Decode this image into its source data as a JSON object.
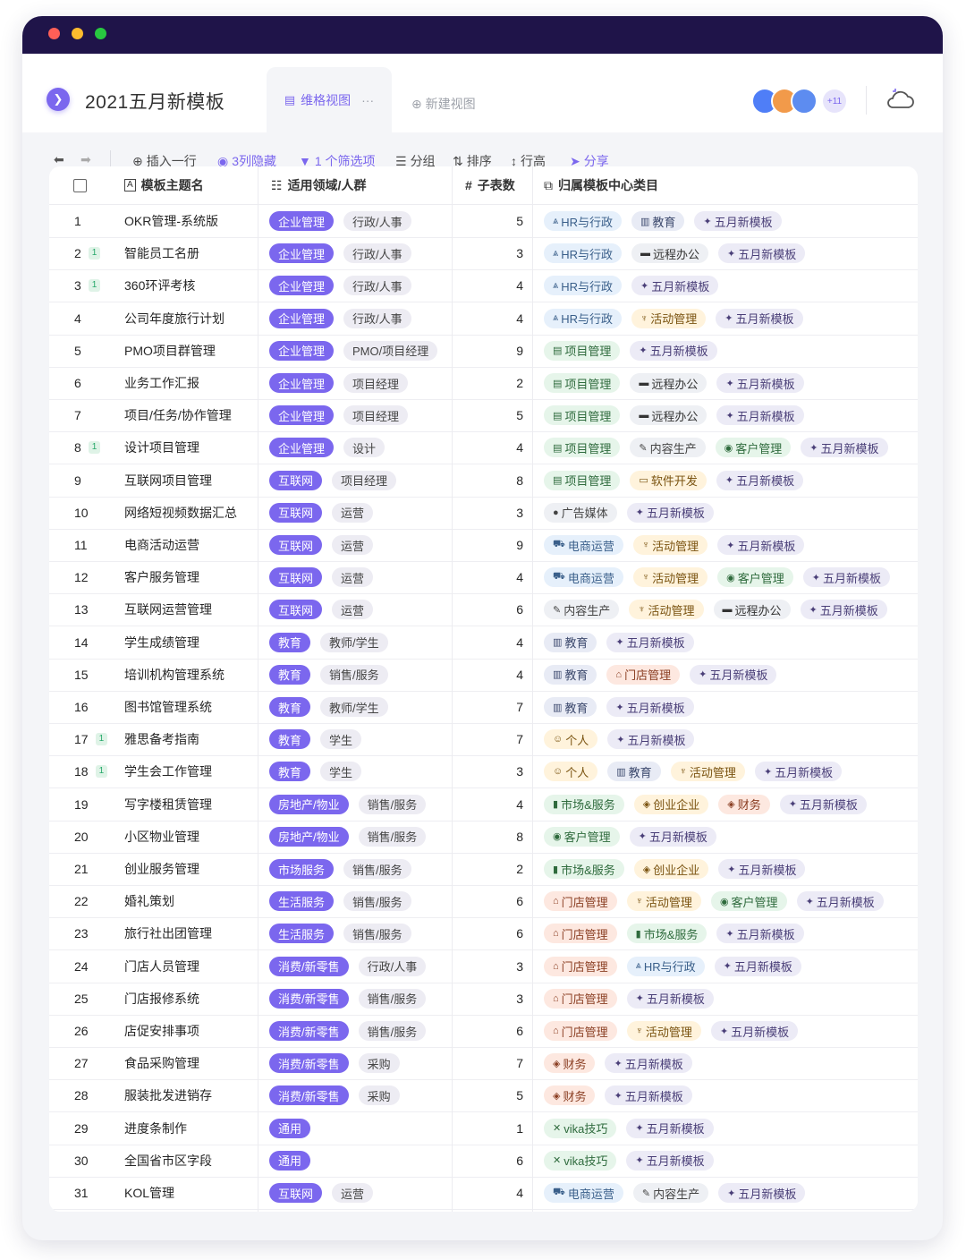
{
  "app": {
    "title": "2021五月新模板",
    "tab_active": "维格视图",
    "tab_more": "···",
    "tab_new": "新建视图",
    "collab_more": "+11"
  },
  "toolbar": {
    "insert_row": "插入一行",
    "hidden_cols": "3列隐藏",
    "filter": "1 个筛选项",
    "group": "分组",
    "sort": "排序",
    "row_height": "行高",
    "share": "分享"
  },
  "columns": {
    "name": "模板主题名",
    "domain": "适用领域/人群",
    "count": "子表数",
    "category": "归属模板中心类目"
  },
  "colors": {
    "accent": "#7b67ee",
    "titlebar": "#1f1449",
    "badge_green": "#27a86a"
  },
  "category_styles": {
    "HR与行政": {
      "icon": "⩓",
      "bg": "#e6f0fb",
      "fg": "#3a5f8a"
    },
    "教育": {
      "icon": "▥",
      "bg": "#e8ebf5",
      "fg": "#3d4a6e"
    },
    "五月新模板": {
      "icon": "✦",
      "bg": "#ecebf6",
      "fg": "#4a3f78"
    },
    "远程办公": {
      "icon": "▬",
      "bg": "#eef0f4",
      "fg": "#333"
    },
    "活动管理": {
      "icon": "♆",
      "bg": "#fff3dc",
      "fg": "#7a5310"
    },
    "项目管理": {
      "icon": "▤",
      "bg": "#e6f5ea",
      "fg": "#2f6b3d"
    },
    "内容生产": {
      "icon": "✎",
      "bg": "#eef0f4",
      "fg": "#444"
    },
    "客户管理": {
      "icon": "◉",
      "bg": "#e6f5ea",
      "fg": "#2f6b3d"
    },
    "软件开发": {
      "icon": "▭",
      "bg": "#fff3dc",
      "fg": "#7a5310"
    },
    "广告媒体": {
      "icon": "●",
      "bg": "#eef0f4",
      "fg": "#444"
    },
    "电商运营": {
      "icon": "⛟",
      "bg": "#e6f0fb",
      "fg": "#3a5f8a"
    },
    "门店管理": {
      "icon": "⌂",
      "bg": "#fde8e0",
      "fg": "#8a3e22"
    },
    "个人": {
      "icon": "☺",
      "bg": "#fff3dc",
      "fg": "#7a5310"
    },
    "市场&服务": {
      "icon": "▮",
      "bg": "#e6f5ea",
      "fg": "#2f6b3d"
    },
    "创业企业": {
      "icon": "◈",
      "bg": "#fff3dc",
      "fg": "#7a5310"
    },
    "财务": {
      "icon": "◈",
      "bg": "#fde8e0",
      "fg": "#8a3e22"
    },
    "vika技巧": {
      "icon": "✕",
      "bg": "#e6f5ea",
      "fg": "#2f6b3d"
    }
  },
  "rows": [
    {
      "no": "1",
      "badge": "",
      "name": "OKR管理-系统版",
      "domain": [
        "企业管理",
        "行政/人事"
      ],
      "count": "5",
      "cats": [
        "HR与行政",
        "教育",
        "五月新模板"
      ]
    },
    {
      "no": "2",
      "badge": "1",
      "name": "智能员工名册",
      "domain": [
        "企业管理",
        "行政/人事"
      ],
      "count": "3",
      "cats": [
        "HR与行政",
        "远程办公",
        "五月新模板"
      ]
    },
    {
      "no": "3",
      "badge": "1",
      "name": "360环评考核",
      "domain": [
        "企业管理",
        "行政/人事"
      ],
      "count": "4",
      "cats": [
        "HR与行政",
        "五月新模板"
      ]
    },
    {
      "no": "4",
      "badge": "",
      "name": "公司年度旅行计划",
      "domain": [
        "企业管理",
        "行政/人事"
      ],
      "count": "4",
      "cats": [
        "HR与行政",
        "活动管理",
        "五月新模板"
      ]
    },
    {
      "no": "5",
      "badge": "",
      "name": "PMO项目群管理",
      "domain": [
        "企业管理",
        "PMO/项目经理"
      ],
      "count": "9",
      "cats": [
        "项目管理",
        "五月新模板"
      ]
    },
    {
      "no": "6",
      "badge": "",
      "name": "业务工作汇报",
      "domain": [
        "企业管理",
        "项目经理"
      ],
      "count": "2",
      "cats": [
        "项目管理",
        "远程办公",
        "五月新模板"
      ]
    },
    {
      "no": "7",
      "badge": "",
      "name": "项目/任务/协作管理",
      "domain": [
        "企业管理",
        "项目经理"
      ],
      "count": "5",
      "cats": [
        "项目管理",
        "远程办公",
        "五月新模板"
      ]
    },
    {
      "no": "8",
      "badge": "1",
      "name": "设计项目管理",
      "domain": [
        "企业管理",
        "设计"
      ],
      "count": "4",
      "cats": [
        "项目管理",
        "内容生产",
        "客户管理",
        "五月新模板"
      ]
    },
    {
      "no": "9",
      "badge": "",
      "name": "互联网项目管理",
      "domain": [
        "互联网",
        "项目经理"
      ],
      "count": "8",
      "cats": [
        "项目管理",
        "软件开发",
        "五月新模板"
      ]
    },
    {
      "no": "10",
      "badge": "",
      "name": "网络短视频数据汇总",
      "domain": [
        "互联网",
        "运营"
      ],
      "count": "3",
      "cats": [
        "广告媒体",
        "五月新模板"
      ]
    },
    {
      "no": "11",
      "badge": "",
      "name": "电商活动运营",
      "domain": [
        "互联网",
        "运营"
      ],
      "count": "9",
      "cats": [
        "电商运营",
        "活动管理",
        "五月新模板"
      ]
    },
    {
      "no": "12",
      "badge": "",
      "name": "客户服务管理",
      "domain": [
        "互联网",
        "运营"
      ],
      "count": "4",
      "cats": [
        "电商运营",
        "活动管理",
        "客户管理",
        "五月新模板"
      ]
    },
    {
      "no": "13",
      "badge": "",
      "name": "互联网运营管理",
      "domain": [
        "互联网",
        "运营"
      ],
      "count": "6",
      "cats": [
        "内容生产",
        "活动管理",
        "远程办公",
        "五月新模板"
      ]
    },
    {
      "no": "14",
      "badge": "",
      "name": "学生成绩管理",
      "domain": [
        "教育",
        "教师/学生"
      ],
      "count": "4",
      "cats": [
        "教育",
        "五月新模板"
      ]
    },
    {
      "no": "15",
      "badge": "",
      "name": "培训机构管理系统",
      "domain": [
        "教育",
        "销售/服务"
      ],
      "count": "4",
      "cats": [
        "教育",
        "门店管理",
        "五月新模板"
      ]
    },
    {
      "no": "16",
      "badge": "",
      "name": "图书馆管理系统",
      "domain": [
        "教育",
        "教师/学生"
      ],
      "count": "7",
      "cats": [
        "教育",
        "五月新模板"
      ]
    },
    {
      "no": "17",
      "badge": "1",
      "name": "雅思备考指南",
      "domain": [
        "教育",
        "学生"
      ],
      "count": "7",
      "cats": [
        "个人",
        "五月新模板"
      ]
    },
    {
      "no": "18",
      "badge": "1",
      "name": "学生会工作管理",
      "domain": [
        "教育",
        "学生"
      ],
      "count": "3",
      "cats": [
        "个人",
        "教育",
        "活动管理",
        "五月新模板"
      ]
    },
    {
      "no": "19",
      "badge": "",
      "name": "写字楼租赁管理",
      "domain": [
        "房地产/物业",
        "销售/服务"
      ],
      "count": "4",
      "cats": [
        "市场&服务",
        "创业企业",
        "财务",
        "五月新模板"
      ]
    },
    {
      "no": "20",
      "badge": "",
      "name": "小区物业管理",
      "domain": [
        "房地产/物业",
        "销售/服务"
      ],
      "count": "8",
      "cats": [
        "客户管理",
        "五月新模板"
      ]
    },
    {
      "no": "21",
      "badge": "",
      "name": "创业服务管理",
      "domain": [
        "市场服务",
        "销售/服务"
      ],
      "count": "2",
      "cats": [
        "市场&服务",
        "创业企业",
        "五月新模板"
      ]
    },
    {
      "no": "22",
      "badge": "",
      "name": "婚礼策划",
      "domain": [
        "生活服务",
        "销售/服务"
      ],
      "count": "6",
      "cats": [
        "门店管理",
        "活动管理",
        "客户管理",
        "五月新模板"
      ]
    },
    {
      "no": "23",
      "badge": "",
      "name": "旅行社出团管理",
      "domain": [
        "生活服务",
        "销售/服务"
      ],
      "count": "6",
      "cats": [
        "门店管理",
        "市场&服务",
        "五月新模板"
      ]
    },
    {
      "no": "24",
      "badge": "",
      "name": "门店人员管理",
      "domain": [
        "消费/新零售",
        "行政/人事"
      ],
      "count": "3",
      "cats": [
        "门店管理",
        "HR与行政",
        "五月新模板"
      ]
    },
    {
      "no": "25",
      "badge": "",
      "name": "门店报修系统",
      "domain": [
        "消费/新零售",
        "销售/服务"
      ],
      "count": "3",
      "cats": [
        "门店管理",
        "五月新模板"
      ]
    },
    {
      "no": "26",
      "badge": "",
      "name": "店促安排事项",
      "domain": [
        "消费/新零售",
        "销售/服务"
      ],
      "count": "6",
      "cats": [
        "门店管理",
        "活动管理",
        "五月新模板"
      ]
    },
    {
      "no": "27",
      "badge": "",
      "name": "食品采购管理",
      "domain": [
        "消费/新零售",
        "采购"
      ],
      "count": "7",
      "cats": [
        "财务",
        "五月新模板"
      ]
    },
    {
      "no": "28",
      "badge": "",
      "name": "服装批发进销存",
      "domain": [
        "消费/新零售",
        "采购"
      ],
      "count": "5",
      "cats": [
        "财务",
        "五月新模板"
      ]
    },
    {
      "no": "29",
      "badge": "",
      "name": "进度条制作",
      "domain": [
        "通用"
      ],
      "count": "1",
      "cats": [
        "vika技巧",
        "五月新模板"
      ]
    },
    {
      "no": "30",
      "badge": "",
      "name": "全国省市区字段",
      "domain": [
        "通用"
      ],
      "count": "6",
      "cats": [
        "vika技巧",
        "五月新模板"
      ]
    },
    {
      "no": "31",
      "badge": "",
      "name": "KOL管理",
      "domain": [
        "互联网",
        "运营"
      ],
      "count": "4",
      "cats": [
        "电商运营",
        "内容生产",
        "五月新模板"
      ]
    }
  ]
}
